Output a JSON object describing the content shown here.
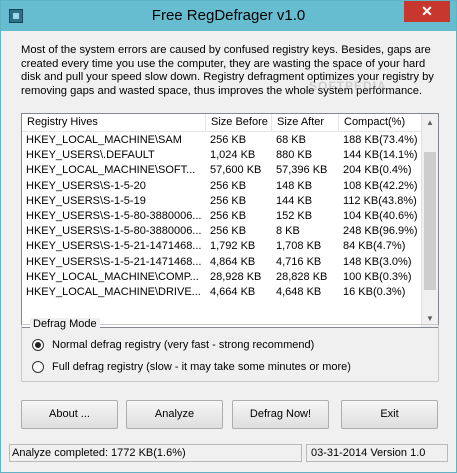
{
  "window": {
    "title": "Free RegDefrager v1.0",
    "close_glyph": "✕"
  },
  "intro_text": "Most of the system errors are caused by confused registry keys. Besides, gaps are created every time you use the computer, they are wasting the space of your hard disk and pull your speed slow down. Registry defragment optimizes your registry by removing gaps and wasted space, thus improves the whole system performance.",
  "watermark": "SOFTPEDIA",
  "table": {
    "columns": [
      "Registry Hives",
      "Size Before",
      "Size After",
      "Compact(%)"
    ],
    "rows": [
      [
        "HKEY_LOCAL_MACHINE\\SAM",
        "256 KB",
        "68 KB",
        "188 KB(73.4%)"
      ],
      [
        "HKEY_USERS\\.DEFAULT",
        "1,024 KB",
        "880 KB",
        "144 KB(14.1%)"
      ],
      [
        "HKEY_LOCAL_MACHINE\\SOFT...",
        "57,600 KB",
        "57,396 KB",
        "204 KB(0.4%)"
      ],
      [
        "HKEY_USERS\\S-1-5-20",
        "256 KB",
        "148 KB",
        "108 KB(42.2%)"
      ],
      [
        "HKEY_USERS\\S-1-5-19",
        "256 KB",
        "144 KB",
        "112 KB(43.8%)"
      ],
      [
        "HKEY_USERS\\S-1-5-80-3880006...",
        "256 KB",
        "152 KB",
        "104 KB(40.6%)"
      ],
      [
        "HKEY_USERS\\S-1-5-80-3880006...",
        "256 KB",
        "8 KB",
        "248 KB(96.9%)"
      ],
      [
        "HKEY_USERS\\S-1-5-21-1471468...",
        "1,792 KB",
        "1,708 KB",
        "84 KB(4.7%)"
      ],
      [
        "HKEY_USERS\\S-1-5-21-1471468...",
        "4,864 KB",
        "4,716 KB",
        "148 KB(3.0%)"
      ],
      [
        "HKEY_LOCAL_MACHINE\\COMP...",
        "28,928 KB",
        "28,828 KB",
        "100 KB(0.3%)"
      ],
      [
        "HKEY_LOCAL_MACHINE\\DRIVE...",
        "4,664 KB",
        "4,648 KB",
        "16 KB(0.3%)"
      ]
    ]
  },
  "defrag_mode": {
    "legend": "Defrag Mode",
    "options": [
      {
        "label": "Normal defrag registry (very fast - strong recommend)",
        "selected": true
      },
      {
        "label": "Full defrag registry (slow - it may take some minutes or more)",
        "selected": false
      }
    ]
  },
  "buttons": {
    "about": "About ...",
    "analyze": "Analyze",
    "defrag": "Defrag Now!",
    "exit": "Exit"
  },
  "status": {
    "left": "Analyze completed: 1772 KB(1.6%)",
    "right": "03-31-2014 Version 1.0"
  }
}
